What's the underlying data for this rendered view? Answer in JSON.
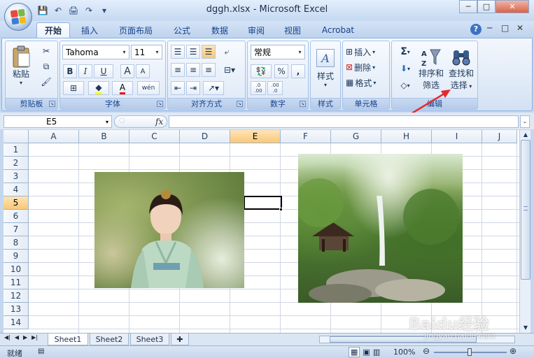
{
  "window": {
    "title": "dggh.xlsx - Microsoft Excel",
    "controls": {
      "minimize": "─",
      "restore": "□",
      "close": "✕"
    }
  },
  "qat": {
    "save": "💾",
    "undo": "↶",
    "print": "🖨",
    "redo": "↷",
    "more": "▾"
  },
  "tabs": [
    {
      "label": "开始",
      "active": true
    },
    {
      "label": "插入"
    },
    {
      "label": "页面布局"
    },
    {
      "label": "公式"
    },
    {
      "label": "数据"
    },
    {
      "label": "审阅"
    },
    {
      "label": "视图"
    },
    {
      "label": "Acrobat"
    }
  ],
  "ribbon_controls": {
    "help": "?",
    "min": "─",
    "restore": "□",
    "close": "✕"
  },
  "ribbon": {
    "clipboard": {
      "label": "剪贴板",
      "paste": "粘贴"
    },
    "font": {
      "label": "字体",
      "name": "Tahoma",
      "size": "11",
      "bold": "B",
      "italic": "I",
      "underline": "U",
      "grow": "A",
      "shrink": "A",
      "font_color": "A",
      "phonetic": "wén"
    },
    "alignment": {
      "label": "对齐方式"
    },
    "number": {
      "label": "数字",
      "format": "常规",
      "percent": "%",
      "comma": ",",
      "inc_decimal": ".0 .00",
      "dec_decimal": ".00 .0"
    },
    "styles": {
      "label": "样式",
      "button": "样式"
    },
    "cells": {
      "label": "单元格",
      "insert": "插入",
      "delete": "删除",
      "format": "格式"
    },
    "editing": {
      "label": "编辑",
      "sum": "Σ",
      "sort_line1": "排序和",
      "sort_line2": "筛选",
      "find_line1": "查找和",
      "find_line2": "选择"
    }
  },
  "formula_bar": {
    "cell_ref": "E5",
    "fx": "fx",
    "value": ""
  },
  "grid": {
    "columns": [
      "A",
      "B",
      "C",
      "D",
      "E",
      "F",
      "G",
      "H",
      "I",
      "J"
    ],
    "rows": [
      "1",
      "2",
      "3",
      "4",
      "5",
      "6",
      "7",
      "8",
      "9",
      "10",
      "11",
      "12",
      "13",
      "14"
    ],
    "active_column": "E",
    "active_row": "5"
  },
  "sheets": [
    "Sheet1",
    "Sheet2",
    "Sheet3"
  ],
  "status": {
    "ready": "就绪",
    "zoom": "100%"
  },
  "watermark": {
    "logo": "Baidu经验",
    "url": "jingyan.baidu.com"
  }
}
